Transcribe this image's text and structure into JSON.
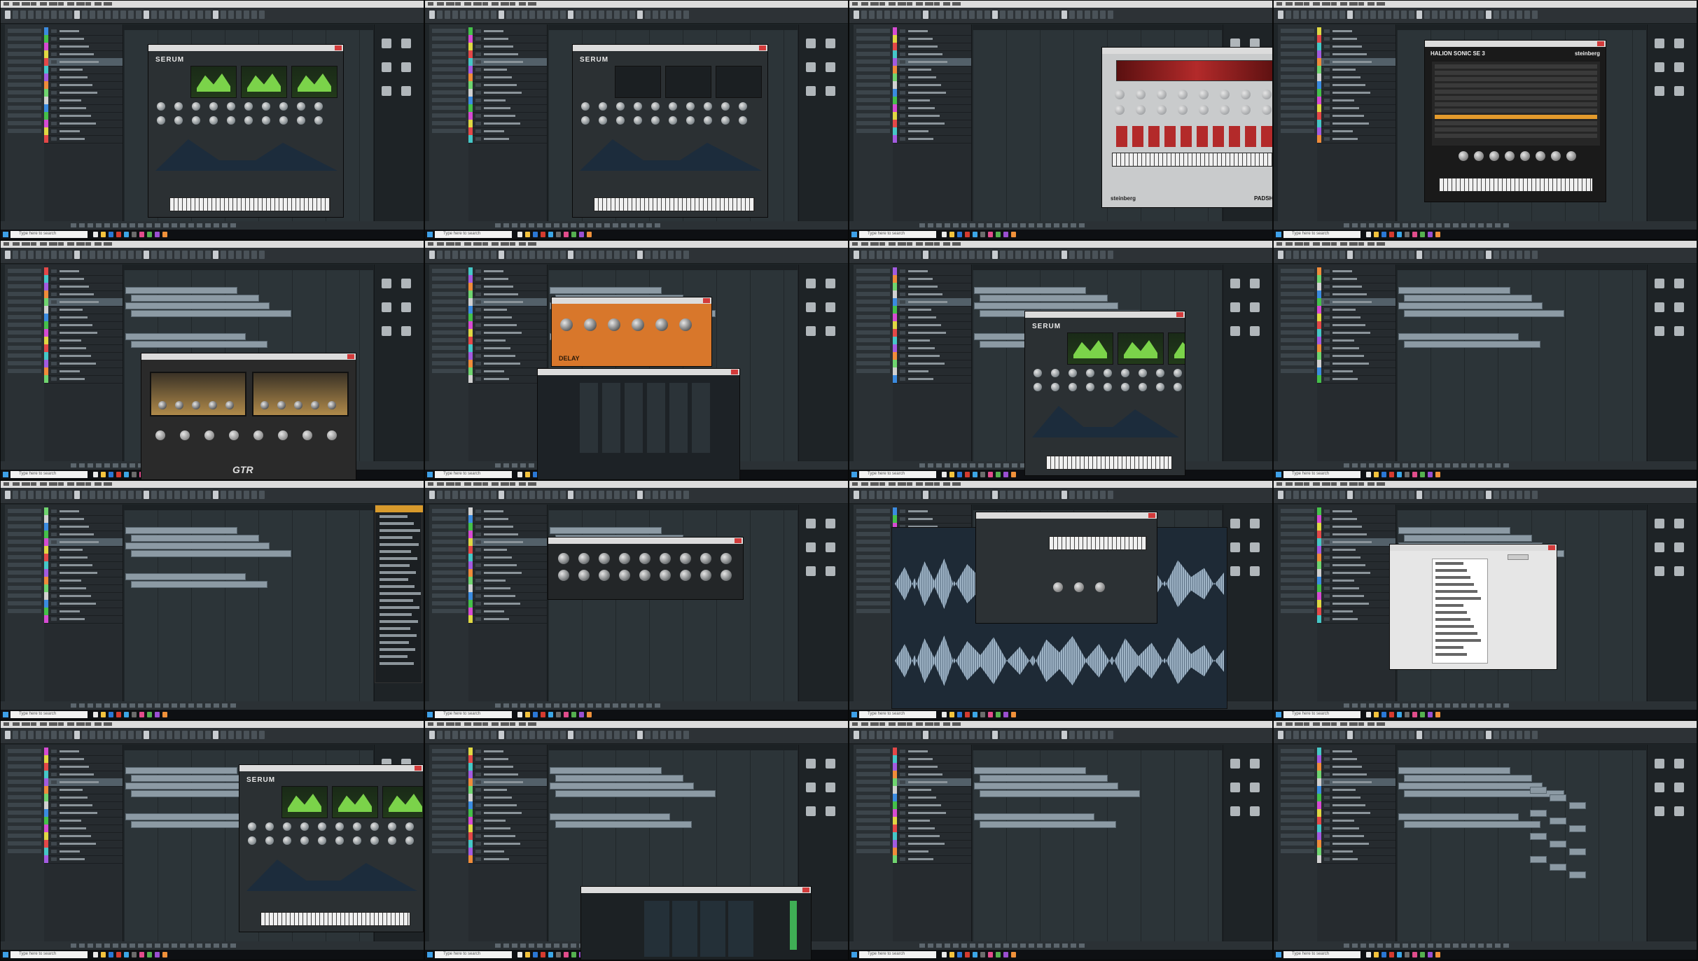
{
  "taskbar": {
    "search_placeholder": "Type here to search"
  },
  "plugins": {
    "serum_logo": "SERUM",
    "steinberg_label": "steinberg",
    "padshop_label": "PADSHOP",
    "halion_label": "HALION SONIC SE 3",
    "amp_logo": "GTR",
    "delay_label": "DELAY"
  },
  "track_colors": [
    "#3b8be0",
    "#45c04a",
    "#d64bd3",
    "#e0d843",
    "#e34848",
    "#46c7c7",
    "#a35be0",
    "#f08c3a",
    "#6fd46f",
    "#d1d1d1"
  ],
  "accent_colors": {
    "serum_green": "#7bd34a",
    "padshop_red": "#b32a2a",
    "delay_orange": "#d8772b",
    "amp_gold": "#b08a4a",
    "halion_orange": "#e39a2c",
    "waveform_blue": "#9fb4c6"
  }
}
